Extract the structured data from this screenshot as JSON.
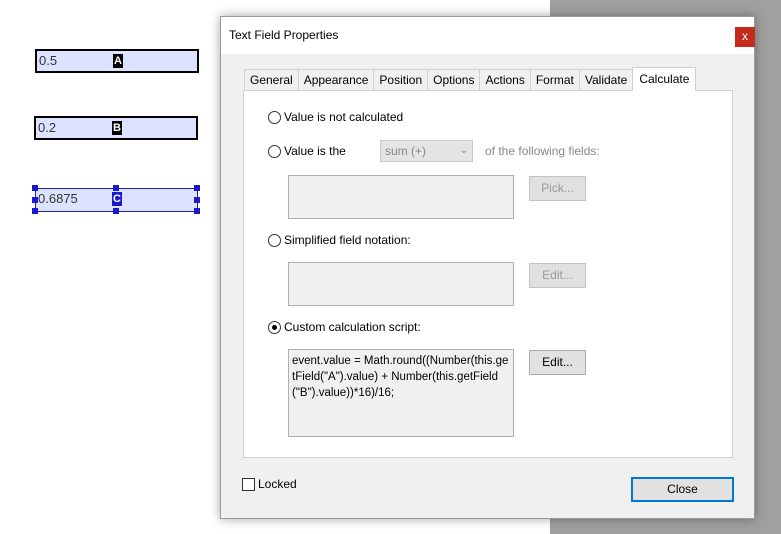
{
  "pdf_fields": [
    {
      "value": "0.5",
      "tag": "A"
    },
    {
      "value": "0.2",
      "tag": "B"
    },
    {
      "value": "0.6875",
      "tag": "C"
    }
  ],
  "dialog": {
    "title": "Text Field Properties",
    "close_glyph": "x",
    "tabs": [
      "General",
      "Appearance",
      "Position",
      "Options",
      "Actions",
      "Format",
      "Validate",
      "Calculate"
    ],
    "active_tab": "Calculate",
    "calculate": {
      "opt_not_calculated": "Value is not calculated",
      "opt_value_is": "Value is the",
      "function_select": "sum (+)",
      "following_fields": "of the following fields:",
      "pick_button": "Pick...",
      "opt_simplified": "Simplified field notation:",
      "simplified_edit_button": "Edit...",
      "opt_custom": "Custom calculation script:",
      "script": "event.value = Math.round((Number(this.getField(\"A\").value) + Number(this.getField(\"B\").value))*16)/16;",
      "custom_edit_button": "Edit...",
      "selected_option": "custom"
    },
    "locked_label": "Locked",
    "locked_checked": false,
    "close_button": "Close"
  }
}
